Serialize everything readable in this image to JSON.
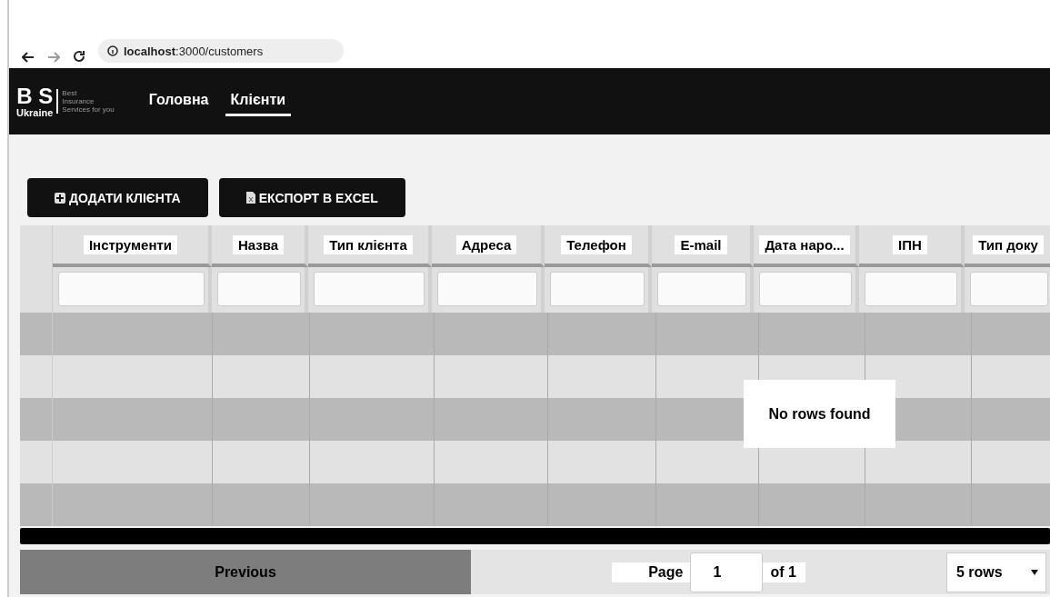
{
  "browser": {
    "url_host": "localhost",
    "url_rest": ":3000/customers"
  },
  "header": {
    "logo": {
      "letters": "B S",
      "sub": "Ukraine",
      "tagline": [
        "Best",
        "Insurance",
        "Services for you"
      ]
    },
    "nav": [
      {
        "label": "Головна",
        "selected": false
      },
      {
        "label": "Клієнти",
        "selected": true
      }
    ]
  },
  "actions": [
    {
      "label": "ДОДАТИ КЛІЄНТА",
      "kind": "add"
    },
    {
      "label": "ЕКСПОРТ В EXCEL",
      "kind": "excel"
    }
  ],
  "table": {
    "columns": [
      "Інструменти",
      "Назва",
      "Тип клієнта",
      "Адреса",
      "Телефон",
      "E-mail",
      "Дата наро...",
      "ІПН",
      "Тип доку"
    ],
    "empty_message": "No rows found"
  },
  "pagination": {
    "previous": "Previous",
    "page_label": "Page",
    "page": "1",
    "of": "of 1",
    "rows": "5 rows"
  }
}
